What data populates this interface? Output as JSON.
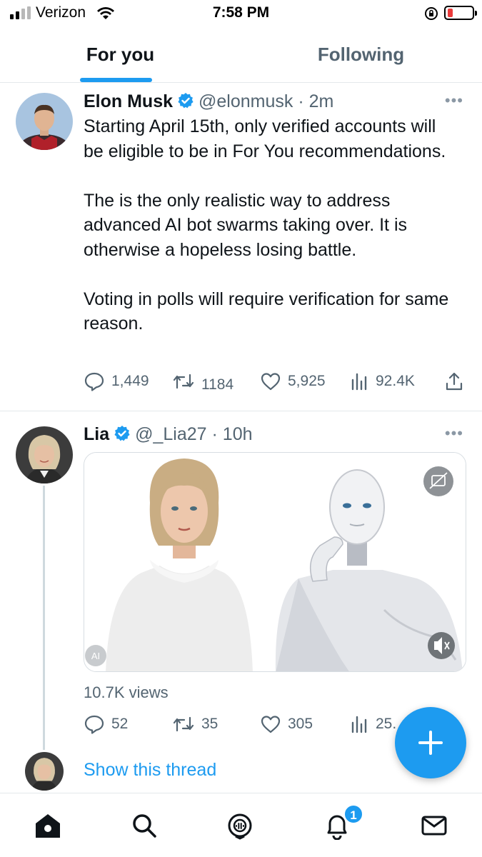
{
  "status_bar": {
    "carrier": "Verizon",
    "time": "7:58 PM",
    "battery_color": "#eb3b3b"
  },
  "tabs": [
    {
      "label": "For you",
      "active": true
    },
    {
      "label": "Following",
      "active": false
    }
  ],
  "accent_color": "#1d9bf0",
  "tweets": [
    {
      "name": "Elon Musk",
      "handle": "@elonmusk",
      "time": "2m",
      "verified": true,
      "paragraphs": [
        "Starting April 15th, only verified accounts will be eligible to be in For You recommendations.",
        "The is the only realistic way to address advanced AI bot swarms taking over. It is otherwise a hopeless losing battle.",
        "Voting in polls will require verification for same reason."
      ],
      "replies": "1,449",
      "retweets": "1184",
      "likes": "5,925",
      "views": "92.4K"
    },
    {
      "name": "Lia",
      "handle": "@_Lia27",
      "time": "10h",
      "verified": true,
      "media_badge": "AI",
      "views_label": "10.7K views",
      "replies": "52",
      "retweets": "35",
      "likes": "305",
      "views": "25."
    }
  ],
  "show_thread": "Show this thread",
  "notifications_badge": "1"
}
